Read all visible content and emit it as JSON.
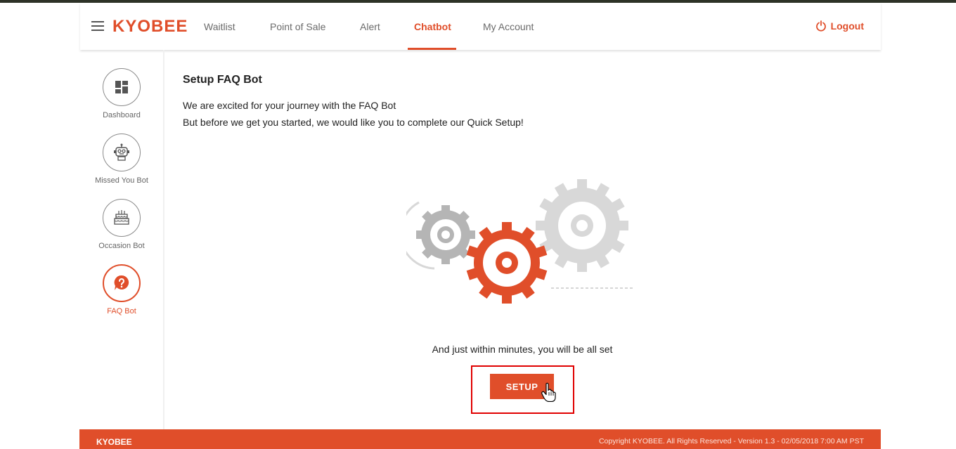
{
  "app": {
    "logo": "KYOBEE"
  },
  "nav": {
    "items": [
      {
        "label": "Waitlist"
      },
      {
        "label": "Point of Sale"
      },
      {
        "label": "Alert"
      },
      {
        "label": "Chatbot"
      },
      {
        "label": "My Account"
      }
    ],
    "active": "Chatbot",
    "logout_label": "Logout"
  },
  "sidebar": {
    "items": [
      {
        "label": "Dashboard",
        "icon": "dashboard-icon"
      },
      {
        "label": "Missed You Bot",
        "icon": "robot-icon"
      },
      {
        "label": "Occasion Bot",
        "icon": "cake-icon"
      },
      {
        "label": "FAQ Bot",
        "icon": "question-icon"
      }
    ],
    "active": "FAQ Bot"
  },
  "main": {
    "title": "Setup FAQ Bot",
    "line1": "We are excited for your journey with the FAQ Bot",
    "line2": "But before we get you started, we would like you to complete our Quick Setup!",
    "illustration": "gears-illustration",
    "allset_text": "And just within minutes, you will be all set",
    "setup_label": "SETUP"
  },
  "footer": {
    "brand": "KYOBEE",
    "copyright": "Copyright KYOBEE. All Rights Reserved - Version 1.3 - 02/05/2018 7:00 AM PST"
  },
  "colors": {
    "accent": "#e04e2a",
    "topstrip": "#2d3227",
    "highlight_frame": "#e00000"
  }
}
